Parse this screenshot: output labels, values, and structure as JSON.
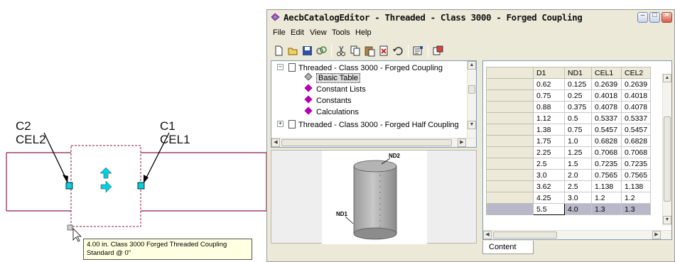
{
  "diagram": {
    "left_callout": {
      "line1": "C2",
      "line2": "CEL2"
    },
    "right_callout": {
      "line1": "C1",
      "line2": "CEL1"
    },
    "tooltip": {
      "line1": "4.00 in. Class 3000 Forged Threaded  Coupling",
      "line2": "Standard @ 0\""
    }
  },
  "window": {
    "title": "AecbCatalogEditor - Threaded - Class 3000 - Forged Coupling",
    "controls": {
      "minimize": "–",
      "maximize": "□",
      "close": "✕"
    }
  },
  "menu": [
    "File",
    "Edit",
    "View",
    "Tools",
    "Help"
  ],
  "toolbar": {
    "icons": [
      "new-icon",
      "open-icon",
      "save-icon",
      "link-icon",
      "cut-icon",
      "copy-icon",
      "paste-icon",
      "delete-icon",
      "undo-icon",
      "properties-icon",
      "catalog-icon"
    ]
  },
  "tree": {
    "root": "Threaded - Class 3000 - Forged Coupling",
    "children": [
      "Basic Table",
      "Constant Lists",
      "Constants",
      "Calculations"
    ],
    "sibling": "Threaded - Class 3000 - Forged Half Coupling"
  },
  "preview": {
    "top_label": "ND2",
    "side_label": "ND1"
  },
  "grid": {
    "columns": [
      "D1",
      "ND1",
      "CEL1",
      "CEL2"
    ],
    "rows": [
      [
        "0.62",
        "0.125",
        "0.2639",
        "0.2639"
      ],
      [
        "0.75",
        "0.25",
        "0.4018",
        "0.4018"
      ],
      [
        "0.88",
        "0.375",
        "0.4078",
        "0.4078"
      ],
      [
        "1.12",
        "0.5",
        "0.5337",
        "0.5337"
      ],
      [
        "1.38",
        "0.75",
        "0.5457",
        "0.5457"
      ],
      [
        "1.75",
        "1.0",
        "0.6828",
        "0.6828"
      ],
      [
        "2.25",
        "1.25",
        "0.7068",
        "0.7068"
      ],
      [
        "2.5",
        "1.5",
        "0.7235",
        "0.7235"
      ],
      [
        "3.0",
        "2.0",
        "0.7565",
        "0.7565"
      ],
      [
        "3.62",
        "2.5",
        "1.138",
        "1.138"
      ],
      [
        "4.25",
        "3.0",
        "1.2",
        "1.2"
      ],
      [
        "5.5",
        "4.0",
        "1.3",
        "1.3"
      ]
    ],
    "tab": "Content"
  },
  "colors": {
    "accent_cyan": "#00d0e0",
    "frame_maroon": "#8b1a4a",
    "tree_diamond": "#b000b0",
    "selected_row": "#b8b8c8"
  }
}
